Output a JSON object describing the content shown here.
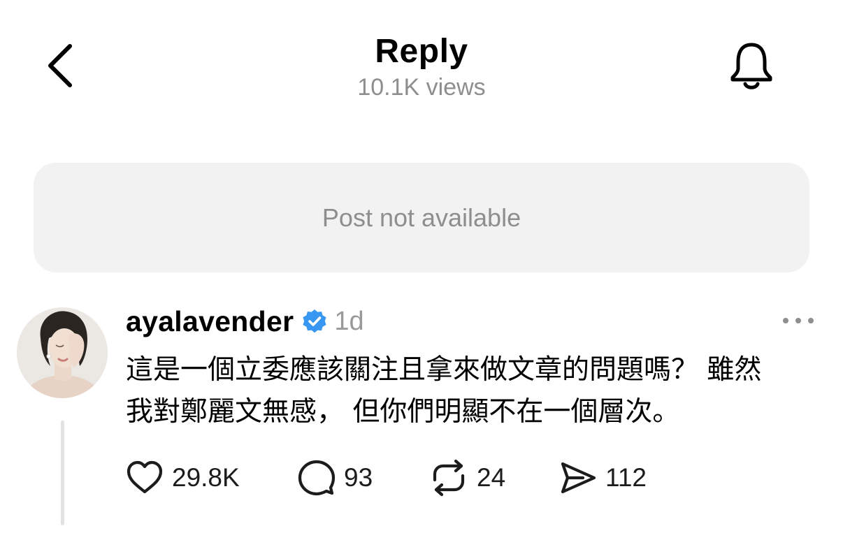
{
  "header": {
    "title": "Reply",
    "views": "10.1K views",
    "back_icon": "chevron-left-icon",
    "notify_icon": "bell-icon"
  },
  "unavailable_post": {
    "text": "Post not available"
  },
  "reply": {
    "username": "ayalavender",
    "verified": true,
    "verified_color": "#3897f0",
    "time": "1d",
    "lines": [
      "這是一個立委應該關注且拿來做文章的問題嗎？ 雖然",
      "我對鄭麗文無感， 但你們明顯不在一個層次。"
    ],
    "actions": {
      "likes": "29.8K",
      "comments": "93",
      "reposts": "24",
      "shares": "112"
    }
  }
}
